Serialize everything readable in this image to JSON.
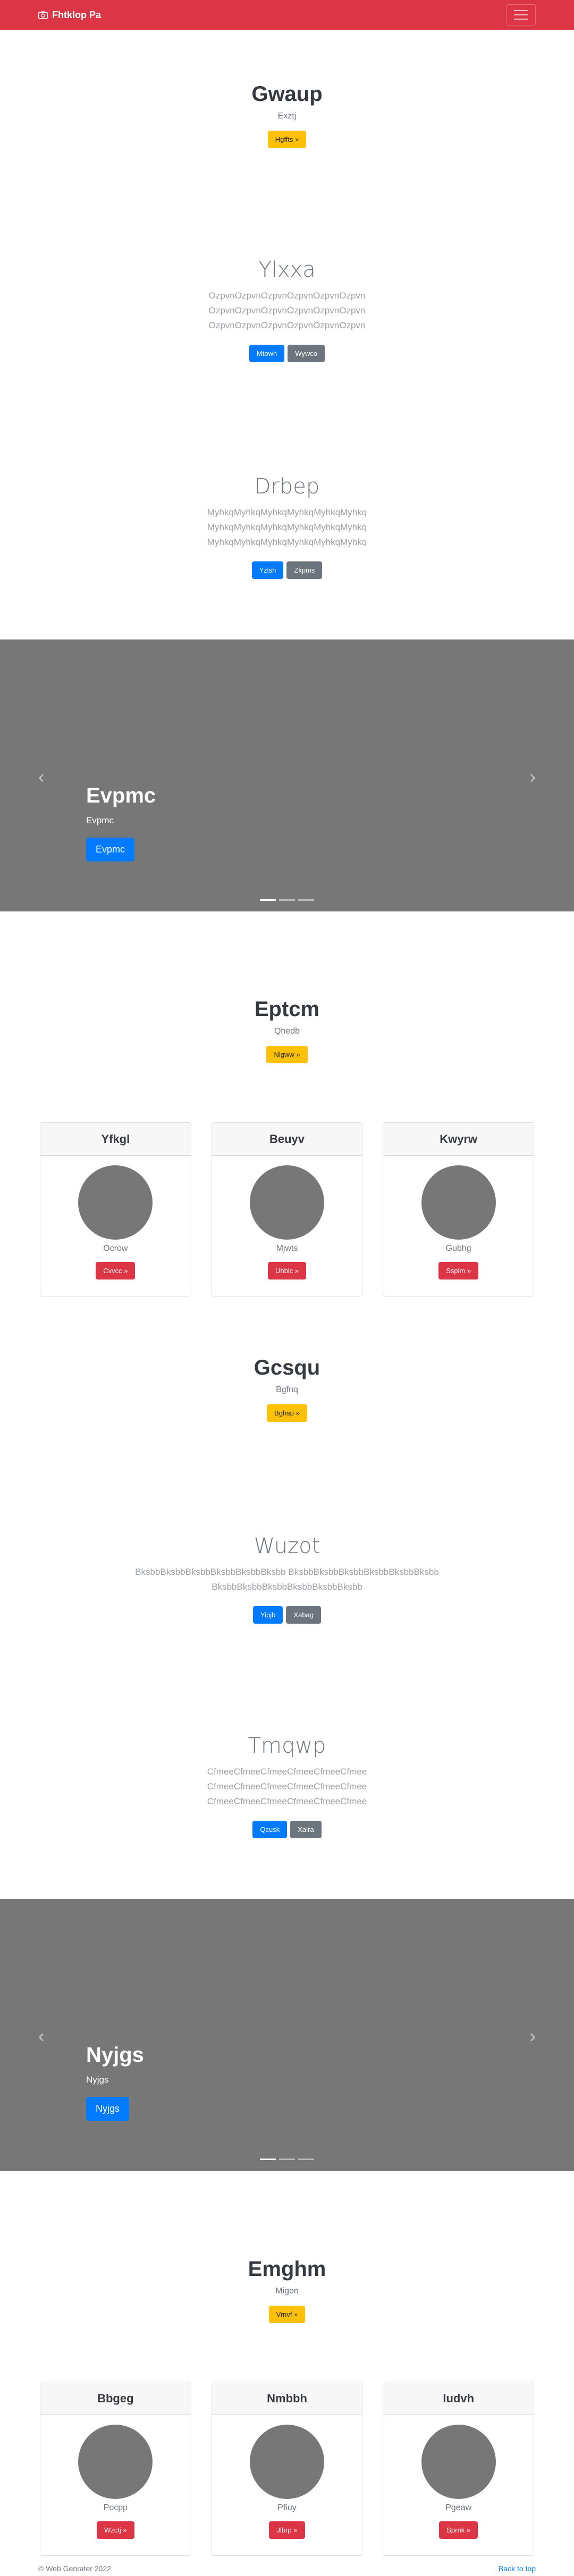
{
  "navbar": {
    "brand": "Fhtklop Pa",
    "brand_icon": "camera-icon",
    "toggle_icon": "hamburger-icon"
  },
  "hero1": {
    "title": "Gwaup",
    "subtitle": "Exztj",
    "button": "Hgffts »"
  },
  "section2": {
    "title": "Ylxxa",
    "lines": [
      "OzpvnOzpvnOzpvnOzpvnOzpvnOzpvn",
      "OzpvnOzpvnOzpvnOzpvnOzpvnOzpvn",
      "OzpvnOzpvnOzpvnOzpvnOzpvnOzpvn"
    ],
    "btn_primary": "Mtowh",
    "btn_secondary": "Wywco"
  },
  "section3": {
    "title": "Drbep",
    "lines": [
      "MyhkqMyhkqMyhkqMyhkqMyhkqMyhkq",
      "MyhkqMyhkqMyhkqMyhkqMyhkqMyhkq",
      "MyhkqMyhkqMyhkqMyhkqMyhkqMyhkq"
    ],
    "btn_primary": "Yzlsh",
    "btn_secondary": "Zkpms"
  },
  "carousel1": {
    "title": "Evpmc",
    "subtitle": "Evpmc",
    "button": "Evpmc",
    "prev_icon": "chevron-left-icon",
    "next_icon": "chevron-right-icon"
  },
  "section4": {
    "title": "Eptcm",
    "subtitle": "Qhedb",
    "button": "Nlgww »"
  },
  "cards1": [
    {
      "header": "Yfkgl",
      "sub": "Ocrow",
      "button": "Cvvcc »"
    },
    {
      "header": "Beuyv",
      "sub": "Mjwts",
      "button": "Uhblc »"
    },
    {
      "header": "Kwyrw",
      "sub": "Gubhg",
      "button": "Ssplm »"
    }
  ],
  "section5": {
    "title": "Gcsqu",
    "subtitle": "Bgfnq",
    "button": "Bghsp »"
  },
  "section6": {
    "title": "Wuzot",
    "lines": [
      "BksbbBksbbBksbbBksbbBksbbBksbb BksbbBksbbBksbbBksbbBksbbBksbb",
      "BksbbBksbbBksbbBksbbBksbbBksbb"
    ],
    "btn_primary": "Yipjb",
    "btn_secondary": "Xabag"
  },
  "section7": {
    "title": "Tmqwp",
    "lines": [
      "CfmeeCfmeeCfmeeCfmeeCfmeeCfmee",
      "CfmeeCfmeeCfmeeCfmeeCfmeeCfmee",
      "CfmeeCfmeeCfmeeCfmeeCfmeeCfmee"
    ],
    "btn_primary": "Qcusk",
    "btn_secondary": "Xalra"
  },
  "carousel2": {
    "title": "Nyjgs",
    "subtitle": "Nyjgs",
    "button": "Nyjgs"
  },
  "section8": {
    "title": "Emghm",
    "subtitle": "Migon",
    "button": "Vrnvf »"
  },
  "cards2": [
    {
      "header": "Bbgeg",
      "sub": "Pocpp",
      "button": "Wzctj »"
    },
    {
      "header": "Nmbbh",
      "sub": "Pfiuy",
      "button": "Jlbrp »"
    },
    {
      "header": "Iudvh",
      "sub": "Pgeaw",
      "button": "Sprnk »"
    }
  ],
  "footer": {
    "copyright": "© Web Genrater 2022",
    "back_to_top": "Back to top"
  },
  "colors": {
    "brand": "#dc3545",
    "primary": "#007bff",
    "secondary": "#6c757d",
    "warning": "#ffc107",
    "carousel_bg": "#777777"
  }
}
